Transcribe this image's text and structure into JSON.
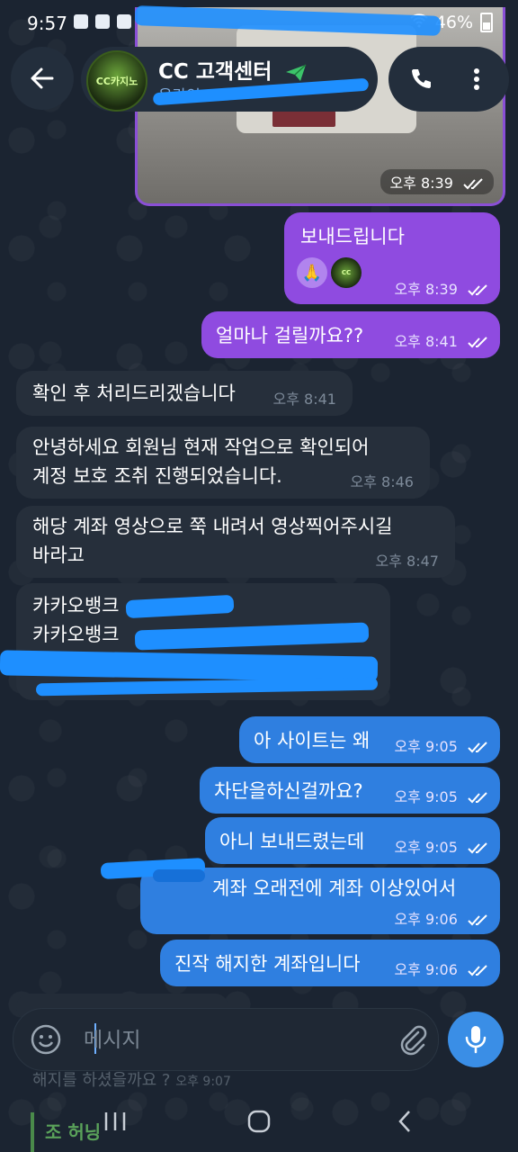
{
  "status_bar": {
    "time": "9:57",
    "battery": "46%"
  },
  "header": {
    "title": "CC 고객센터",
    "status": "온라인",
    "avatar_label": "CC카지노"
  },
  "image_message": {
    "time": "오후 8:39"
  },
  "messages": [
    {
      "text": "보내드립니다",
      "time": "오후 8:39",
      "direction": "out"
    },
    {
      "text": "얼마나 걸릴까요??",
      "time": "오후 8:41",
      "direction": "out"
    },
    {
      "text": "확인 후 처리드리겠습니다",
      "time": "오후 8:41",
      "direction": "in"
    },
    {
      "line1": "안녕하세요 회원님 현재 작업으로 확인되어",
      "line2": "계정 보호 조취 진행되었습니다.",
      "time": "오후 8:46",
      "direction": "in"
    },
    {
      "line1": "해당 계좌 영상으로 쭉 내려서 영상찍어주시길",
      "line2": "바라고",
      "time": "오후 8:47",
      "direction": "in"
    },
    {
      "line1": "카카오뱅크",
      "line2": "카카오뱅크",
      "direction": "in"
    },
    {
      "text": "아 사이트는 왜",
      "time": "오후 9:05",
      "direction": "out"
    },
    {
      "text": "차단을하신걸까요?",
      "time": "오후 9:05",
      "direction": "out"
    },
    {
      "text": "아니 보내드렸는데",
      "time": "오후 9:05",
      "direction": "out"
    },
    {
      "text": "계좌 오래전에 계좌 이상있어서",
      "time": "오후 9:06",
      "direction": "out"
    },
    {
      "text": "진작 해지한 계좌입니다",
      "time": "오후 9:06",
      "direction": "out"
    }
  ],
  "reaction": {
    "emoji": "🙏"
  },
  "input": {
    "placeholder": "메시지"
  },
  "behind": {
    "text": "해지를 하셨을까요 ?",
    "time": "오후 9:07",
    "name": "조 허닝"
  },
  "colors": {
    "outgoing": "#2f7fe0",
    "outgoing_purple": "#8f4be0",
    "incoming": "#262f3b",
    "background": "#1b2431"
  }
}
